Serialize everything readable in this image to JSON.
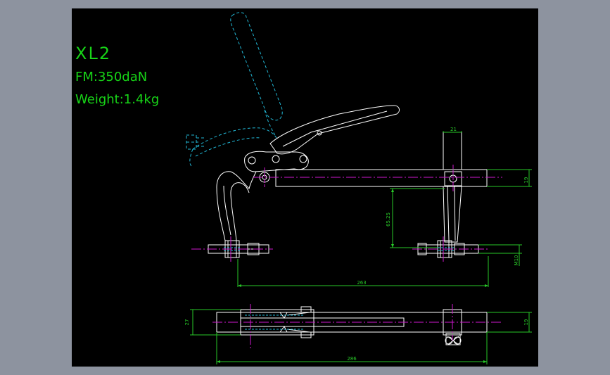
{
  "title": {
    "model": "XL2",
    "force": "FM:350daN",
    "weight": "Weight:1.4kg"
  },
  "dimensions": {
    "arm_width": "21",
    "bar_height": "19",
    "vertical_adjust": "65.25",
    "thread": "M10",
    "reach": "263",
    "base_height": "27",
    "base_bar_height": "19",
    "overall_length": "286"
  },
  "colors": {
    "background": "#000000",
    "outline": "#ffffff",
    "dashed_phantom": "#22b8d6",
    "dimension": "#28c828",
    "centerline": "#d017d0",
    "title_text": "#17d417",
    "frame": "#8d939f"
  }
}
